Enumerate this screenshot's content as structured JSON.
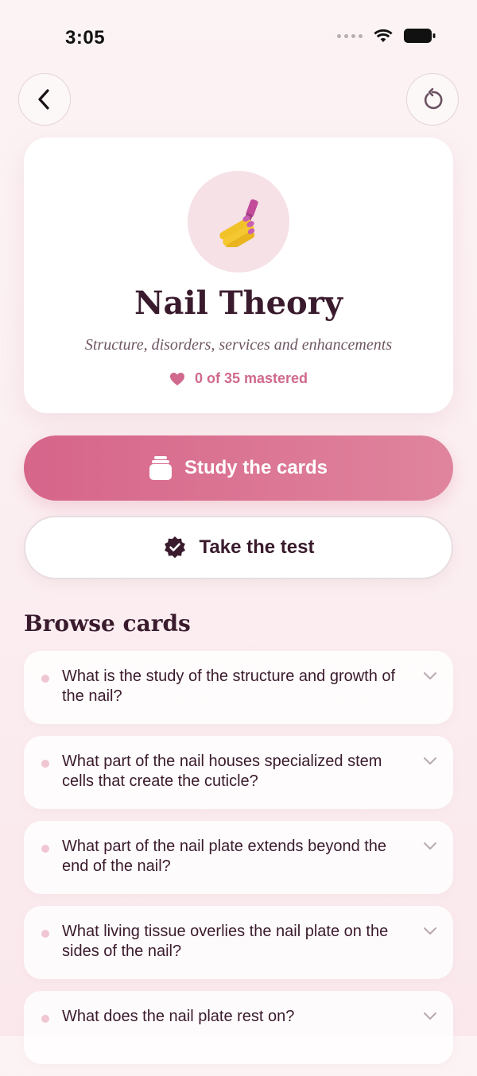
{
  "status_bar": {
    "time": "3:05"
  },
  "deck": {
    "emoji": "💅",
    "title": "Nail Theory",
    "subtitle": "Structure, disorders, services and enhancements",
    "mastered": "0 of 35 mastered"
  },
  "actions": {
    "study_label": "Study the cards",
    "test_label": "Take the test"
  },
  "browse": {
    "title": "Browse cards",
    "items": [
      {
        "question": "What is the study of the structure and growth of the nail?"
      },
      {
        "question": "What part of the nail houses specialized stem cells that create the cuticle?"
      },
      {
        "question": "What part of the nail plate extends beyond the end of the nail?"
      },
      {
        "question": "What living tissue overlies the nail plate on the sides of the nail?"
      },
      {
        "question": "What does the nail plate rest on?"
      }
    ]
  },
  "colors": {
    "accent": "#d6658a",
    "title": "#3a1b2d",
    "background": "#fbeff1"
  },
  "icons": {
    "back": "chevron-left-icon",
    "reset": "reset-icon",
    "mastered": "heart-icon",
    "study": "cards-stack-icon",
    "test": "verified-badge-icon",
    "expand": "chevron-down-icon"
  }
}
